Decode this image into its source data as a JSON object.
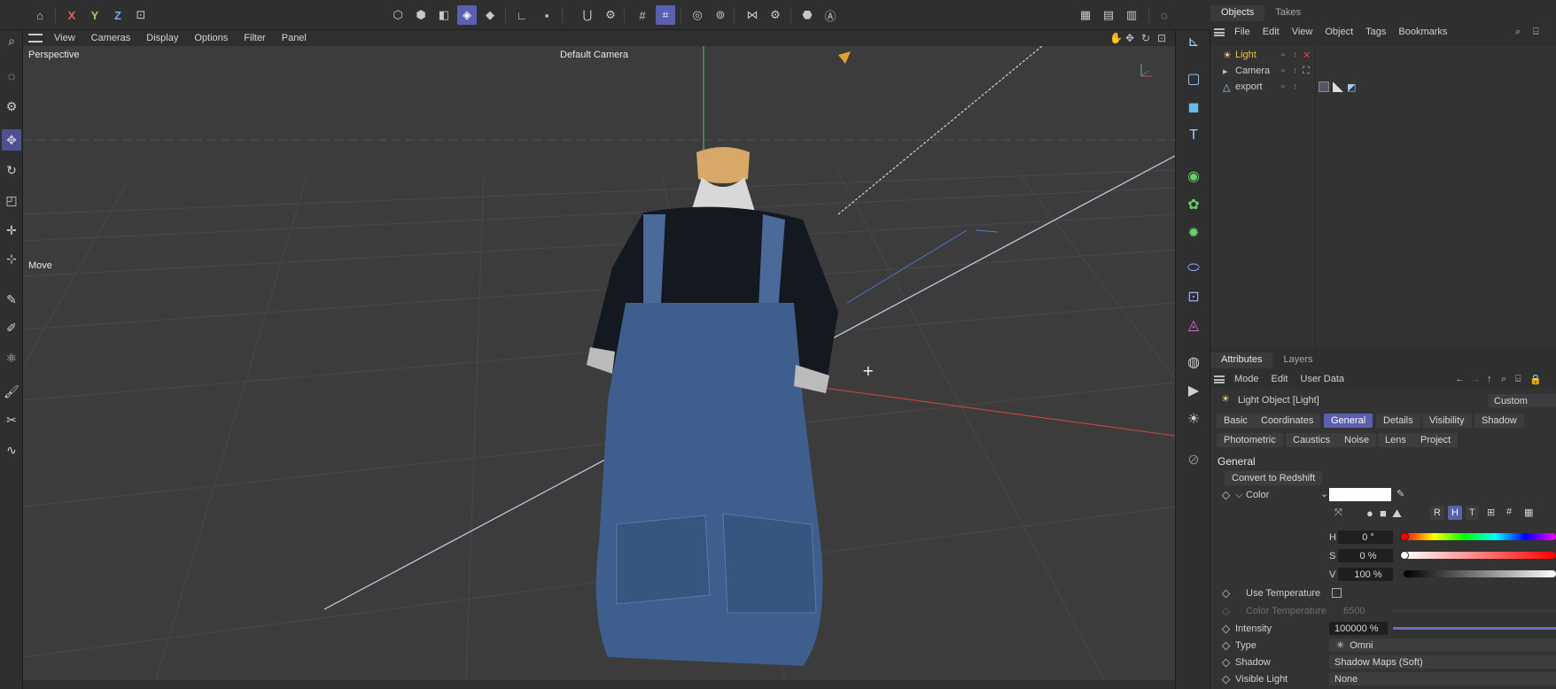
{
  "toolbar": {
    "axis_x": "X",
    "axis_y": "Y",
    "axis_z": "Z"
  },
  "viewport": {
    "menu": [
      "View",
      "Cameras",
      "Display",
      "Options",
      "Filter",
      "Panel"
    ],
    "view_name": "Perspective",
    "camera_name": "Default Camera",
    "tool_label": "Move",
    "colors": {
      "grid": "#4a4a4a",
      "background": "#3c3c3c",
      "x_axis": "#d04848",
      "y_axis": "#58c058",
      "z_axis": "#4878d0",
      "light_line": "#c8d4f0"
    }
  },
  "objects_panel": {
    "tabs": [
      "Objects",
      "Takes"
    ],
    "menu": [
      "File",
      "Edit",
      "View",
      "Object",
      "Tags",
      "Bookmarks"
    ],
    "rows": [
      {
        "name": "Light",
        "icon": "light-icon",
        "highlight_color": "#f0c040"
      },
      {
        "name": "Camera",
        "icon": "camera-icon"
      },
      {
        "name": "export",
        "icon": "polygon-object-icon"
      }
    ]
  },
  "attributes_panel": {
    "tabs": [
      "Attributes",
      "Layers"
    ],
    "menu": [
      "Mode",
      "Edit",
      "User Data"
    ],
    "object_title": "Light Object [Light]",
    "preset": "Custom",
    "tab_buttons_row1": [
      "Basic",
      "Coordinates",
      "General",
      "Details",
      "Visibility",
      "Shadow"
    ],
    "tab_buttons_row2": [
      "Photometric",
      "Caustics",
      "Noise",
      "Lens",
      "Project"
    ],
    "active_tab": "General",
    "section_title": "General",
    "convert_button": "Convert to Redshift",
    "color_label": "Color",
    "color_value": "#ffffff",
    "color_modes": [
      "R",
      "H",
      "T"
    ],
    "h_label": "H",
    "h_value": "0 °",
    "s_label": "S",
    "s_value": "0 %",
    "v_label": "V",
    "v_value": "100 %",
    "use_temperature_label": "Use Temperature",
    "color_temperature_label": "Color Temperature",
    "color_temperature_value": "6500",
    "intensity_label": "Intensity",
    "intensity_value": "100000 %",
    "type_label": "Type",
    "type_value": "Omni",
    "shadow_label": "Shadow",
    "shadow_value": "Shadow Maps (Soft)",
    "visible_light_label": "Visible Light",
    "visible_light_value": "None"
  }
}
